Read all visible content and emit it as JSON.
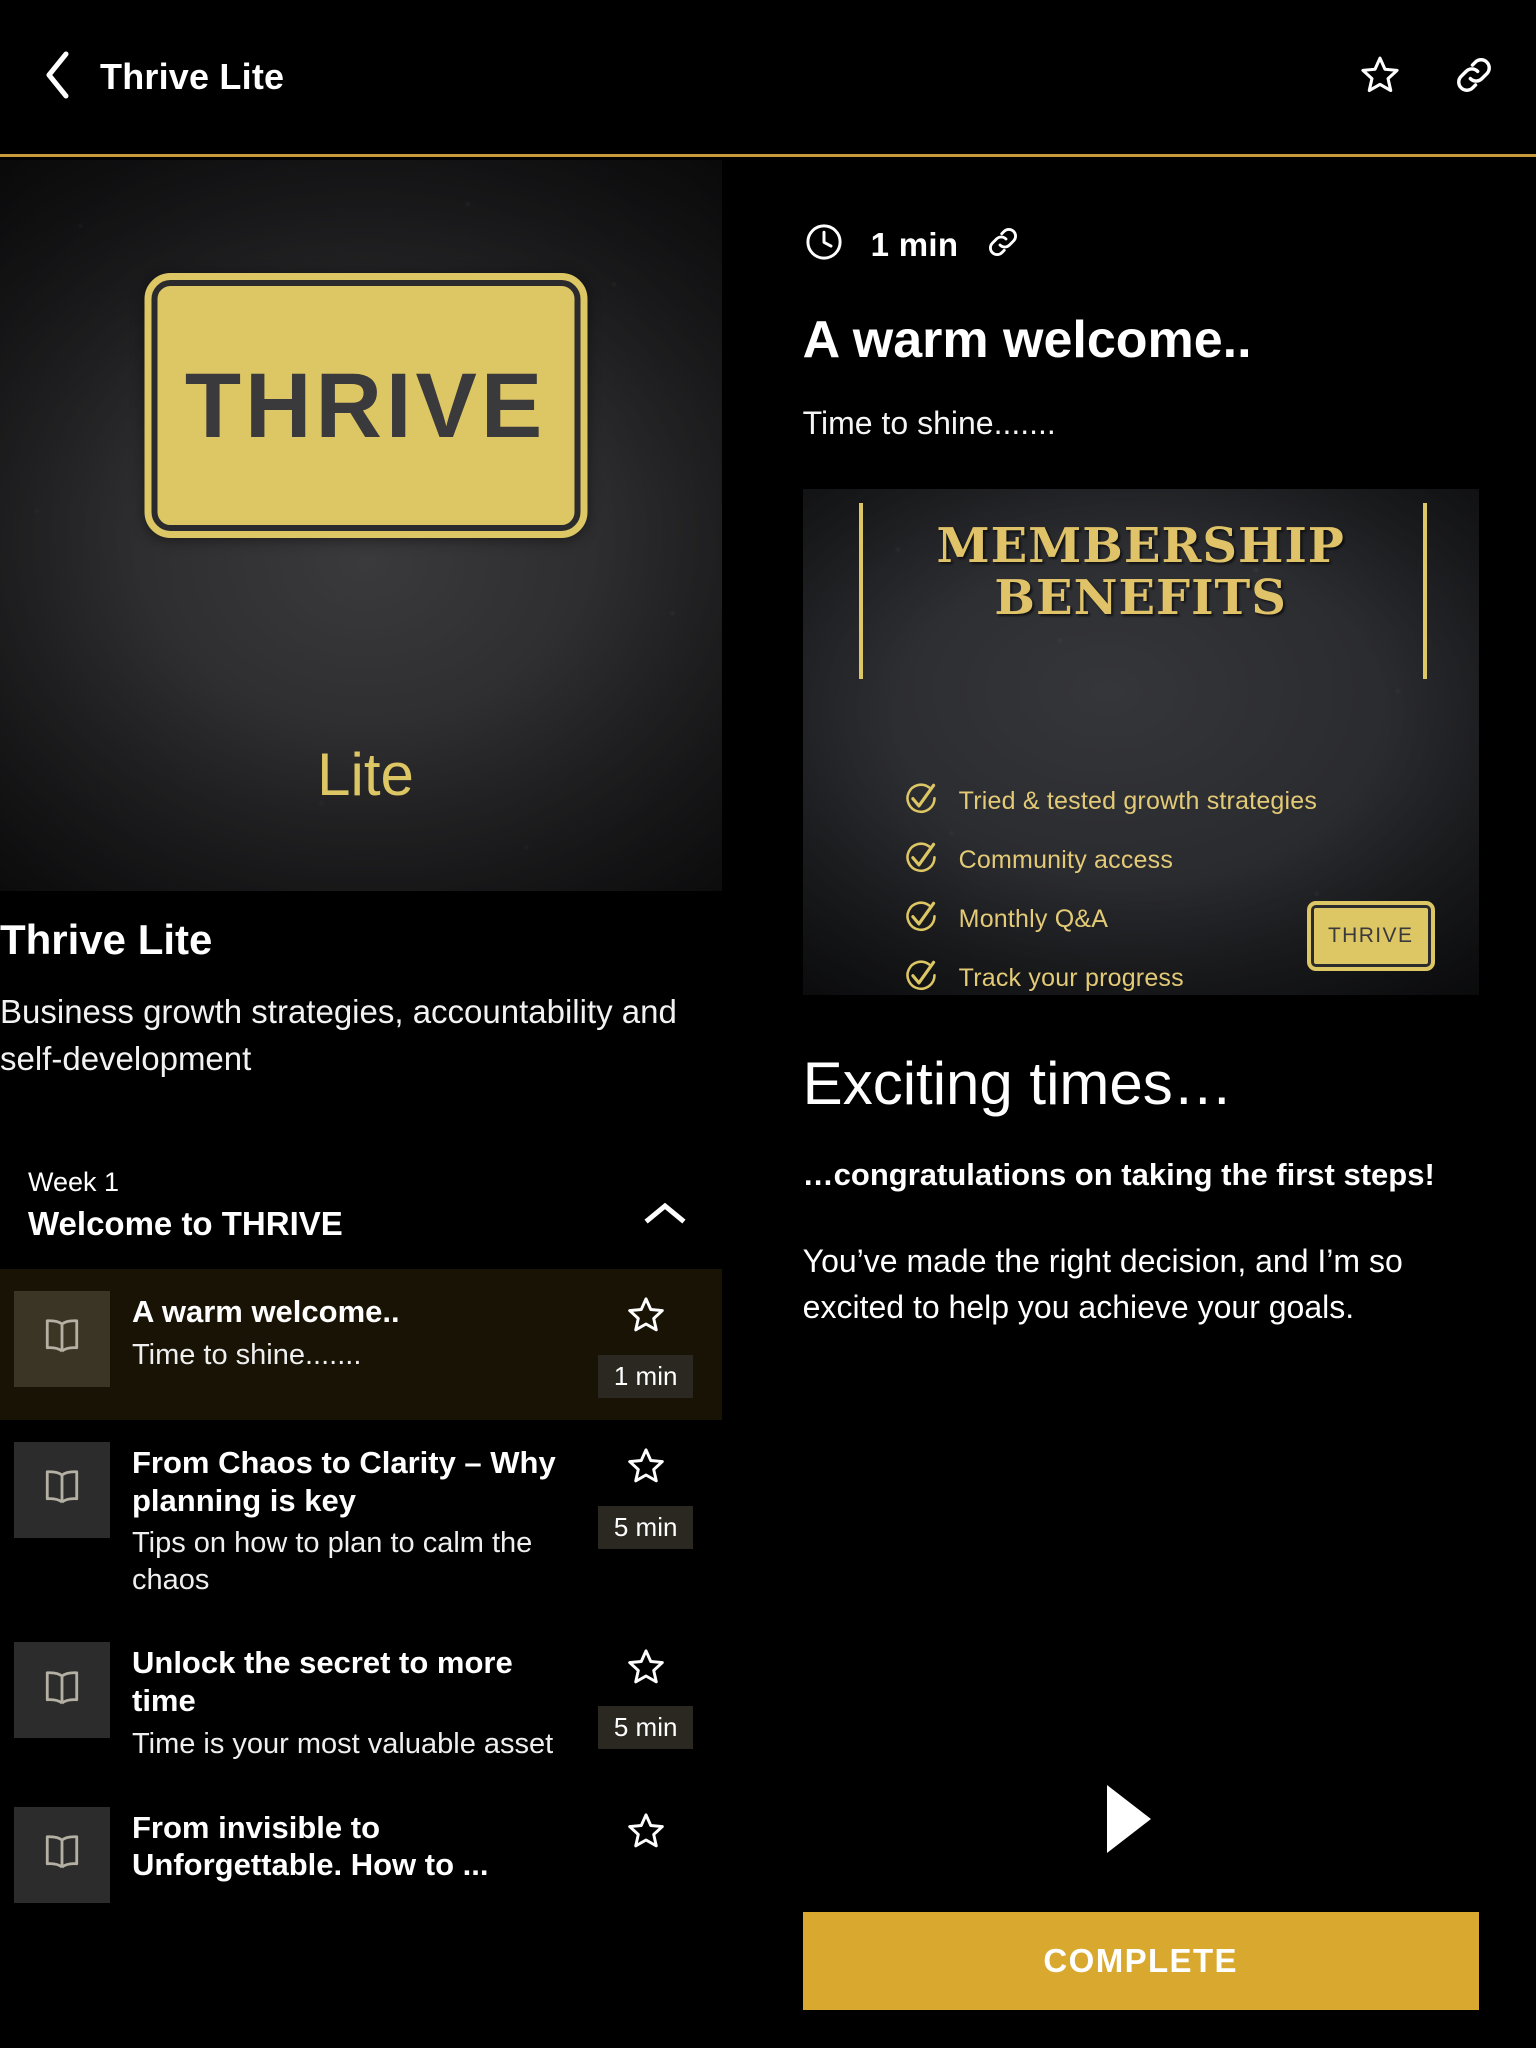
{
  "appbar": {
    "back_icon": "chevron-left-icon",
    "title": "Thrive Lite",
    "favorite_icon": "star-outline-icon",
    "share_icon": "link-icon"
  },
  "course": {
    "cover": {
      "plaque_text": "THRIVE",
      "subtitle": "Lite"
    },
    "title": "Thrive Lite",
    "description": "Business growth strategies, accountability and self-development",
    "section": {
      "week_label": "Week 1",
      "week_title": "Welcome to THRIVE",
      "collapse_icon": "chevron-up-icon"
    },
    "lessons": [
      {
        "icon": "open-book-icon",
        "title": "A warm welcome..",
        "subtitle": "Time to shine.......",
        "duration": "1 min",
        "star_icon": "star-outline-icon",
        "active": true
      },
      {
        "icon": "open-book-icon",
        "title": "From Chaos to Clarity – Why planning is key",
        "subtitle": "Tips on how to plan to calm the chaos",
        "duration": "5 min",
        "star_icon": "star-outline-icon",
        "active": false
      },
      {
        "icon": "open-book-icon",
        "title": "Unlock the secret to more time",
        "subtitle": "Time is your most valuable asset",
        "duration": "5 min",
        "star_icon": "star-outline-icon",
        "active": false
      },
      {
        "icon": "open-book-icon",
        "title": "From invisible to Unforgettable. How to ...",
        "subtitle": "",
        "duration": "",
        "star_icon": "star-outline-icon",
        "active": false
      }
    ]
  },
  "detail": {
    "clock_icon": "clock-icon",
    "duration": "1 min",
    "share_icon": "link-icon",
    "heading": "A warm welcome..",
    "tagline": "Time to shine.......",
    "benefits_image": {
      "heading_line1": "MEMBERSHIP",
      "heading_line2": "BENEFITS",
      "items": [
        "Tried & tested growth strategies",
        "Community access",
        "Monthly Q&A",
        "Track your progress"
      ],
      "badge_text": "THRIVE",
      "check_icon": "circle-check-icon"
    },
    "body_heading": "Exciting times…",
    "body_bold": "…congratulations on taking the first steps!",
    "body_paragraph": "You’ve made the right decision, and I’m so excited to help you achieve your goals.",
    "play_icon": "play-icon",
    "complete_label": "COMPLETE"
  },
  "colors": {
    "accent_gold": "#d9a82e",
    "plaque_gold": "#ddc664",
    "divider_gold": "#c79a3b",
    "background": "#000000",
    "active_row": "#181305"
  }
}
